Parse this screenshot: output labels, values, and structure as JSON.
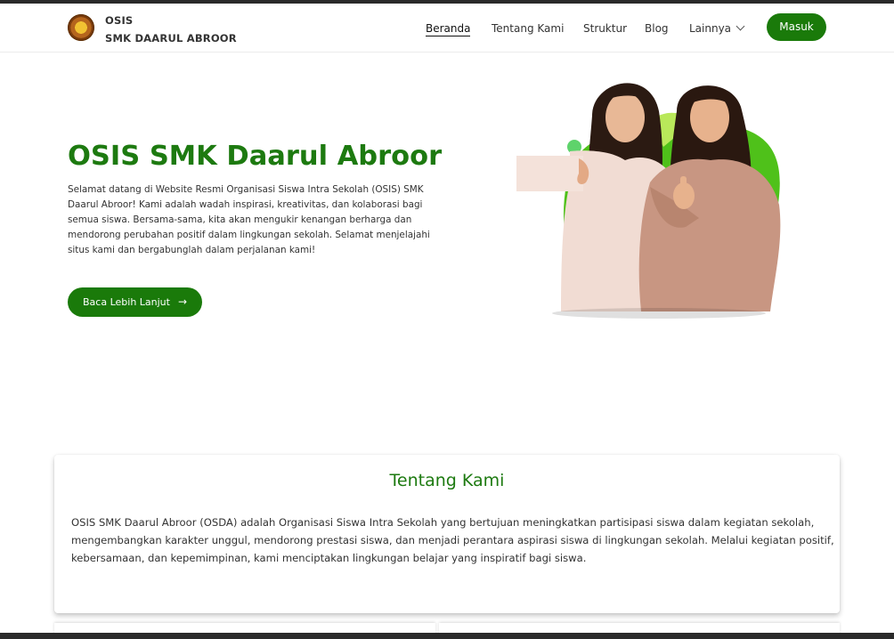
{
  "brand": {
    "line1": "OSIS",
    "line2": "SMK DAARUL ABROOR",
    "logo_icon": "school-emblem-icon"
  },
  "nav": {
    "items": [
      {
        "label": "Beranda",
        "active": true
      },
      {
        "label": "Tentang Kami"
      },
      {
        "label": "Struktur"
      },
      {
        "label": "Blog"
      },
      {
        "label": "Lainnya",
        "dropdown": true
      }
    ],
    "login_label": "Masuk"
  },
  "hero": {
    "title": "OSIS SMK Daarul Abroor",
    "description": "Selamat datang di Website Resmi Organisasi Siswa Intra Sekolah (OSIS) SMK Daarul Abroor! Kami adalah wadah inspirasi, kreativitas, dan kolaborasi bagi semua siswa. Bersama-sama, kita akan mengukir kenangan berharga dan mendorong perubahan positif dalam lingkungan sekolah. Selamat menjelajahi situs kami dan bergabunglah dalam perjalanan kami!",
    "cta_label": "Baca Lebih Lanjut",
    "cta_icon": "arrow-right-icon",
    "image_icon": "two-students-illustration"
  },
  "about": {
    "title": "Tentang Kami",
    "text": "OSIS SMK Daarul Abroor (OSDA) adalah Organisasi Siswa Intra Sekolah yang bertujuan meningkatkan partisipasi siswa dalam kegiatan sekolah, mengembangkan karakter unggul, mendorong prestasi siswa, dan menjadi perantara aspirasi siswa di lingkungan sekolah. Melalui kegiatan positif, kebersamaan, dan kepemimpinan, kami menciptakan lingkungan belajar yang inspiratif bagi siswa."
  },
  "colors": {
    "brand_green": "#1a7a0a",
    "title_green": "#1d7a10",
    "accent_lime": "#6fd12a"
  }
}
